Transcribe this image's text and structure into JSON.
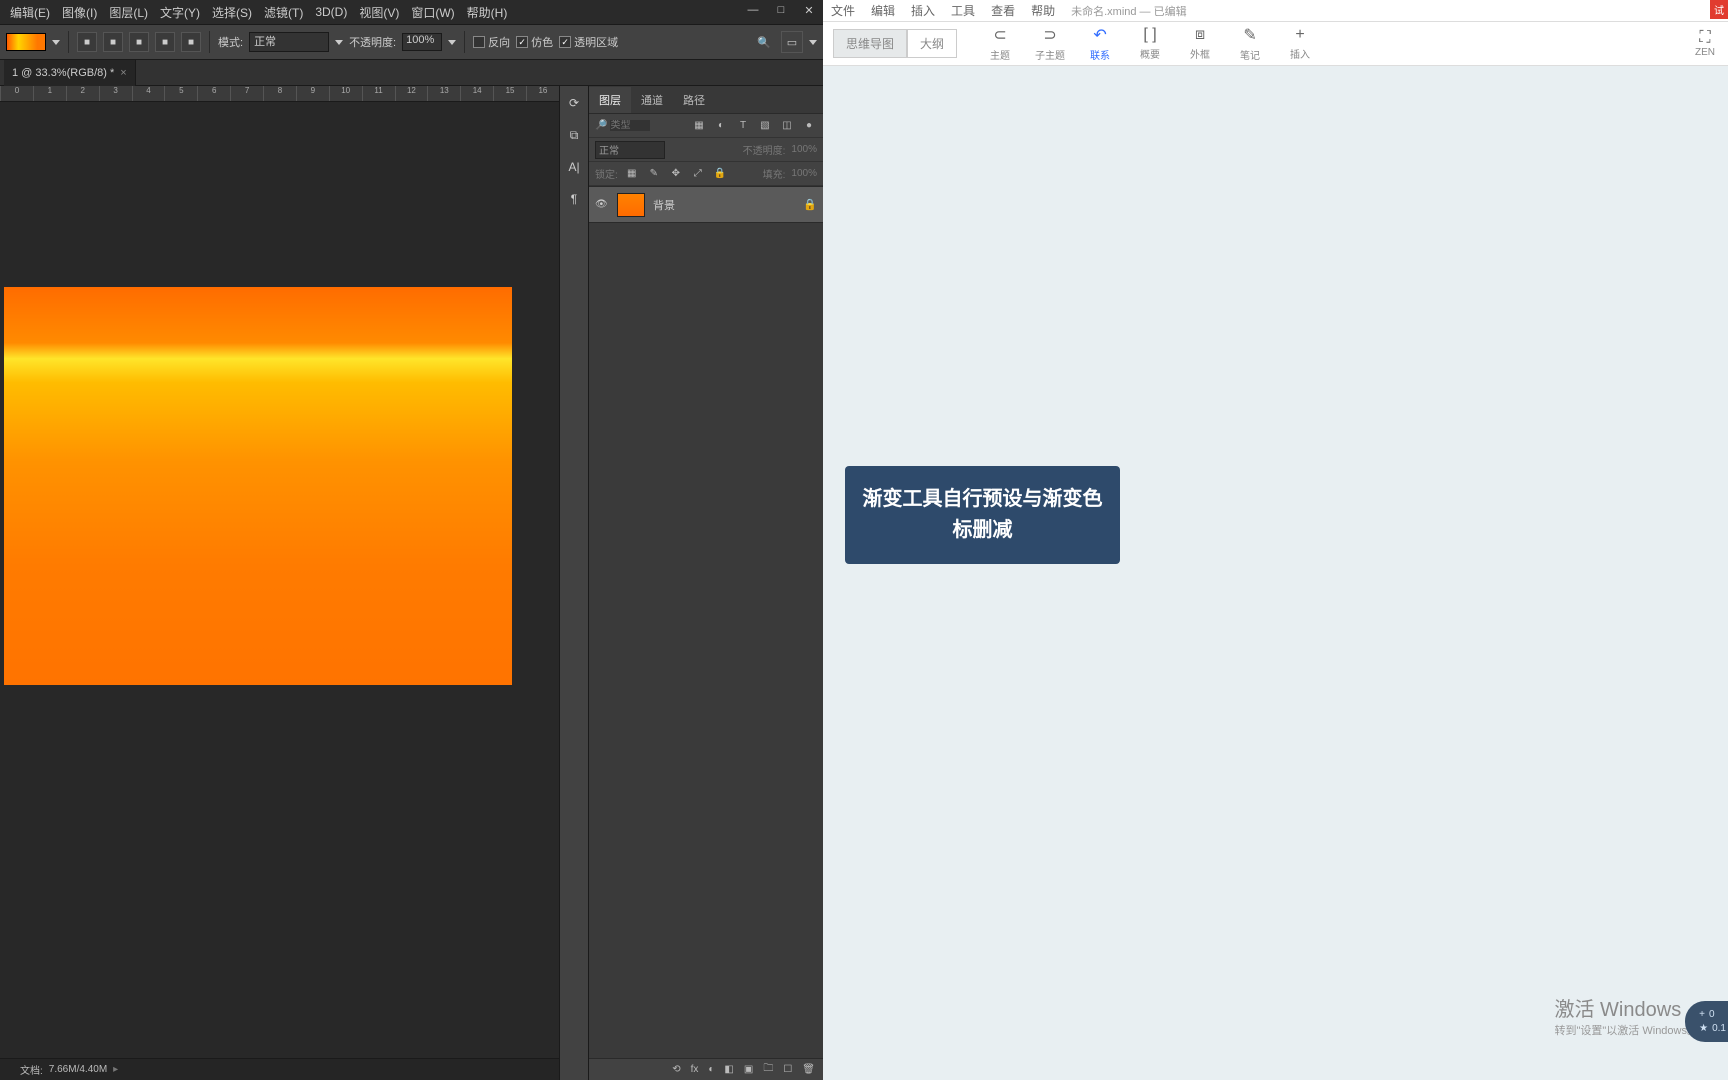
{
  "ps": {
    "menu": [
      "编辑(E)",
      "图像(I)",
      "图层(L)",
      "文字(Y)",
      "选择(S)",
      "滤镜(T)",
      "3D(D)",
      "视图(V)",
      "窗口(W)",
      "帮助(H)"
    ],
    "win": {
      "min": "—",
      "max": "□",
      "close": "✕"
    },
    "options": {
      "grad_types": [
        "■",
        "■",
        "■",
        "■",
        "■"
      ],
      "mode_label": "模式:",
      "mode_value": "正常",
      "opacity_label": "不透明度:",
      "opacity_value": "100%",
      "reverse_label": "反向",
      "reverse_on": false,
      "dither_label": "仿色",
      "dither_on": true,
      "transparency_label": "透明区域",
      "transparency_on": true
    },
    "tab": {
      "title": "1 @ 33.3%(RGB/8) *"
    },
    "ruler": [
      "0",
      "1",
      "2",
      "3",
      "4",
      "5",
      "6",
      "7",
      "8",
      "9",
      "10",
      "11",
      "12",
      "13",
      "14",
      "15",
      "16"
    ],
    "vtools": [
      "⟳",
      "⧉",
      "A|",
      "¶"
    ],
    "panels": {
      "tabs": [
        "图层",
        "通道",
        "路径"
      ],
      "search_placeholder": "类型",
      "kind_icons": [
        "▦",
        "◐",
        "T",
        "▧",
        "◫",
        "●"
      ],
      "blend": "正常",
      "opacity_label": "不透明度:",
      "opacity_value": "100%",
      "lock_label": "锁定:",
      "lock_icons": [
        "▦",
        "✎",
        "✥",
        "⤢",
        "🔒"
      ],
      "fill_label": "填充:",
      "fill_value": "100%",
      "layer_name": "背景",
      "footer_icons": [
        "⟲",
        "fx",
        "◐",
        "◧",
        "▣",
        "🗀",
        "☐",
        "🗑"
      ]
    },
    "status": {
      "label": "文档:",
      "value": "7.66M/4.40M",
      "arrow": "▸"
    }
  },
  "xm": {
    "menu": [
      "文件",
      "编辑",
      "插入",
      "工具",
      "查看",
      "帮助"
    ],
    "doc": "未命名.xmind  — 已编辑",
    "badge": "试",
    "tabs": {
      "map": "思维导图",
      "outline": "大纲"
    },
    "toolbar": [
      {
        "ico": "⊂",
        "lab": "主题"
      },
      {
        "ico": "⊃",
        "lab": "子主题"
      },
      {
        "ico": "↶",
        "lab": "联系",
        "active": true
      },
      {
        "ico": "[ ]",
        "lab": "概要"
      },
      {
        "ico": "⧈",
        "lab": "外框"
      },
      {
        "ico": "✎",
        "lab": "笔记"
      },
      {
        "ico": "+",
        "lab": "插入"
      }
    ],
    "zen": {
      "ico": "⛶",
      "lab": "ZEN"
    },
    "node": "渐变工具自行预设与渐变色标删减",
    "activate": {
      "title": "激活 Windows",
      "sub": "转到\"设置\"以激活 Windows。"
    },
    "zoom": {
      "plus": "+",
      "v1": "0",
      "star": "★",
      "v2": "0.1"
    }
  }
}
